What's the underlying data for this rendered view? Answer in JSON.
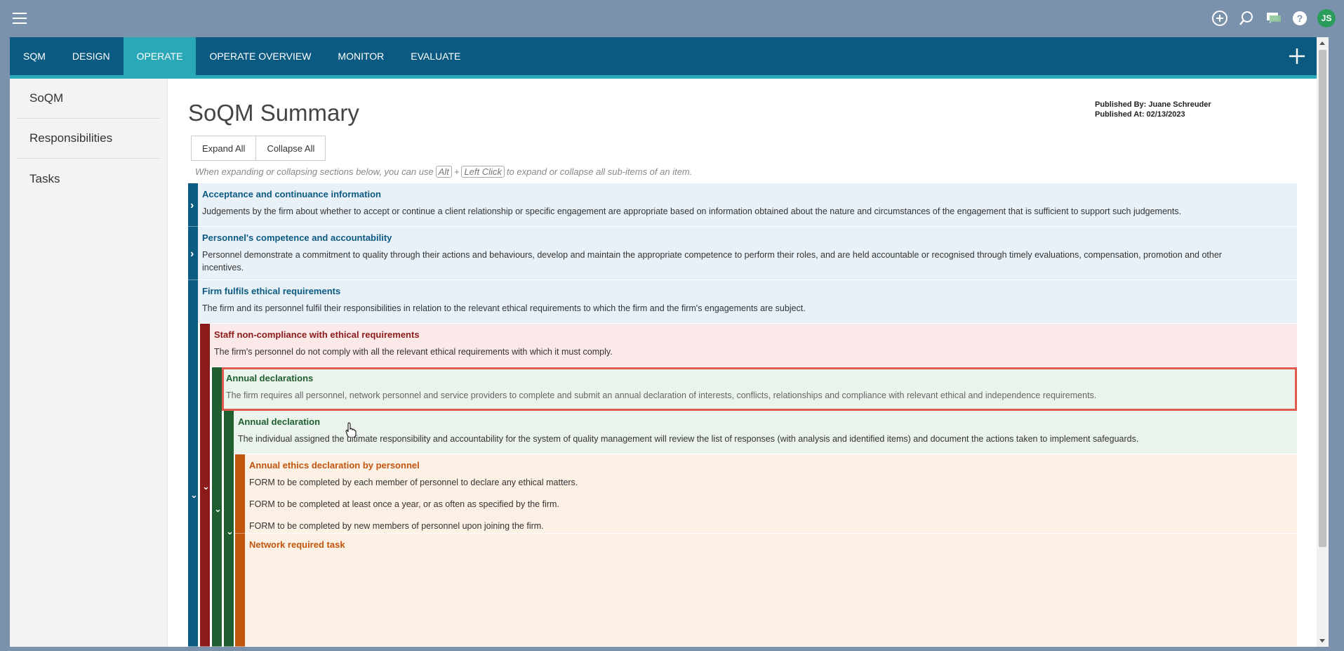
{
  "topbar": {
    "icons": [
      "menu-icon",
      "add-circle-icon",
      "search-icon",
      "chat-icon",
      "help-icon"
    ],
    "avatar_initials": "JS",
    "avatar_color": "#2a9d5c"
  },
  "nav": {
    "tabs": [
      {
        "label": "SQM",
        "active": false
      },
      {
        "label": "DESIGN",
        "active": false
      },
      {
        "label": "OPERATE",
        "active": true
      },
      {
        "label": "OPERATE OVERVIEW",
        "active": false
      },
      {
        "label": "MONITOR",
        "active": false
      },
      {
        "label": "EVALUATE",
        "active": false
      }
    ],
    "bg_color": "#0b5a82",
    "active_color": "#2aa8b8"
  },
  "sidebar": {
    "items": [
      {
        "label": "SoQM"
      },
      {
        "label": "Responsibilities"
      },
      {
        "label": "Tasks"
      }
    ]
  },
  "main": {
    "title": "SoQM Summary",
    "published_by": "Published By: Juane Schreuder",
    "published_at": "Published At: 02/13/2023",
    "expand_all": "Expand All",
    "collapse_all": "Collapse All",
    "hint_pre": "When expanding or collapsing sections below, you can use",
    "hint_key1": "Alt",
    "hint_plus": "+",
    "hint_key2": "Left Click",
    "hint_post": "to expand or collapse all sub-items of an item."
  },
  "tree": {
    "rows": [
      {
        "title": "Acceptance and continuance information",
        "lines": [
          "Judgements by the firm about whether to accept or continue a client relationship or specific engagement are appropriate based on information obtained about the nature and circumstances of the engagement that is sufficient to support such judgements."
        ]
      },
      {
        "title": "Personnel's competence and accountability",
        "lines": [
          "Personnel demonstrate a commitment to quality through their actions and behaviours, develop and maintain the appropriate competence to perform their roles, and are held accountable or recognised through timely evaluations, compensation, promotion and other",
          "incentives."
        ]
      },
      {
        "title": "Firm fulfils ethical requirements",
        "lines": [
          "The firm and its personnel fulfil their responsibilities in relation to the relevant ethical requirements to which the firm and the firm's engagements are subject."
        ]
      },
      {
        "title": "Staff non-compliance with ethical requirements",
        "lines": [
          "The firm's personnel do not comply with all the relevant ethical requirements with which it must comply."
        ]
      },
      {
        "title": "Annual declarations",
        "lines": [
          "The firm requires all personnel, network personnel and service providers to complete and submit an annual declaration of interests, conflicts, relationships and compliance with relevant ethical and independence requirements."
        ]
      },
      {
        "title": "Annual declaration",
        "lines": [
          "The individual assigned the ultimate responsibility and accountability for the system of quality management will review the list of responses (with analysis and identified items) and document the actions taken to implement safeguards."
        ]
      },
      {
        "title": "Annual ethics declaration by personnel",
        "lines": [
          "FORM to be completed by each member of personnel to declare any ethical matters.",
          "FORM to be completed at least once a year, or as often as specified by the firm.",
          "FORM to be completed by new members of personnel upon joining the firm."
        ]
      },
      {
        "title": "Network required task",
        "lines": []
      }
    ],
    "colors": {
      "blue": "#0b5a82",
      "blue_bg": "#e8f1f8",
      "red": "#8b1a1a",
      "red_bg": "#fbe8e8",
      "green": "#1f5e2e",
      "green_bg": "#eaf4ec",
      "orange": "#c2560e",
      "orange_bg": "#fdf0e4",
      "highlight": "#e05a4e"
    }
  }
}
